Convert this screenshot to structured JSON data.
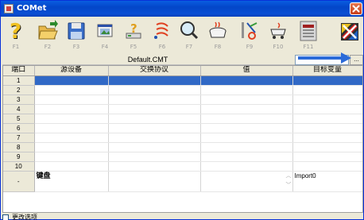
{
  "window": {
    "title": "COMet",
    "titlebar_color": "#0a5de0"
  },
  "toolbar": {
    "buttons": [
      {
        "key": "F1",
        "icon": "help-question-icon"
      },
      {
        "key": "F2",
        "icon": "open-folder-icon"
      },
      {
        "key": "F3",
        "icon": "save-floppy-icon"
      },
      {
        "key": "F4",
        "icon": "image-window-icon"
      },
      {
        "key": "F5",
        "icon": "device-help-icon"
      },
      {
        "key": "F6",
        "icon": "signal-icon"
      },
      {
        "key": "F7",
        "icon": "magnifier-icon"
      },
      {
        "key": "F8",
        "icon": "pot-icon"
      },
      {
        "key": "F9",
        "icon": "tools-icon"
      },
      {
        "key": "F10",
        "icon": "cart-icon"
      },
      {
        "key": "F11",
        "icon": "disabled-panel-icon"
      },
      {
        "key": "",
        "icon": "exit-app-icon"
      }
    ]
  },
  "filebar": {
    "filename": "Default.CMT",
    "file_value": "",
    "browse_label": "..."
  },
  "grid": {
    "columns": [
      "端口",
      "源设备",
      "交换协议",
      "值",
      "目标变量"
    ],
    "rows": [
      {
        "index": "1",
        "selected": true
      },
      {
        "index": "2"
      },
      {
        "index": "3"
      },
      {
        "index": "4"
      },
      {
        "index": "5"
      },
      {
        "index": "6"
      },
      {
        "index": "7"
      },
      {
        "index": "8"
      },
      {
        "index": "9"
      },
      {
        "index": "10"
      }
    ],
    "special_row": {
      "index": "-",
      "source": "键盘",
      "protocol": "",
      "value": "",
      "target": "Import0"
    },
    "selection_color": "#3169c6"
  },
  "footer": {
    "option_label": "更改选项",
    "checked": false
  }
}
